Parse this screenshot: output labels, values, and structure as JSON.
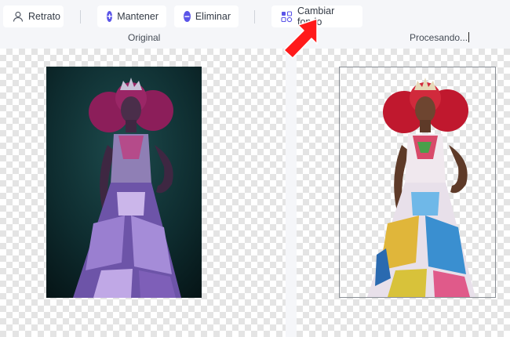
{
  "toolbar": {
    "portrait_label": "Retrato",
    "keep_label": "Mantener",
    "keep_symbol": "+",
    "remove_label": "Eliminar",
    "remove_symbol": "−",
    "change_bg_label": "Cambiar fondo"
  },
  "columns": {
    "original_title": "Original",
    "processing_title": "Procesando..."
  },
  "colors": {
    "accent": "#5b55e8",
    "arrow": "#ff1a1a"
  },
  "icons": [
    "user-icon",
    "plus-circle-icon",
    "minus-circle-icon",
    "change-background-icon",
    "red-arrow-icon"
  ]
}
